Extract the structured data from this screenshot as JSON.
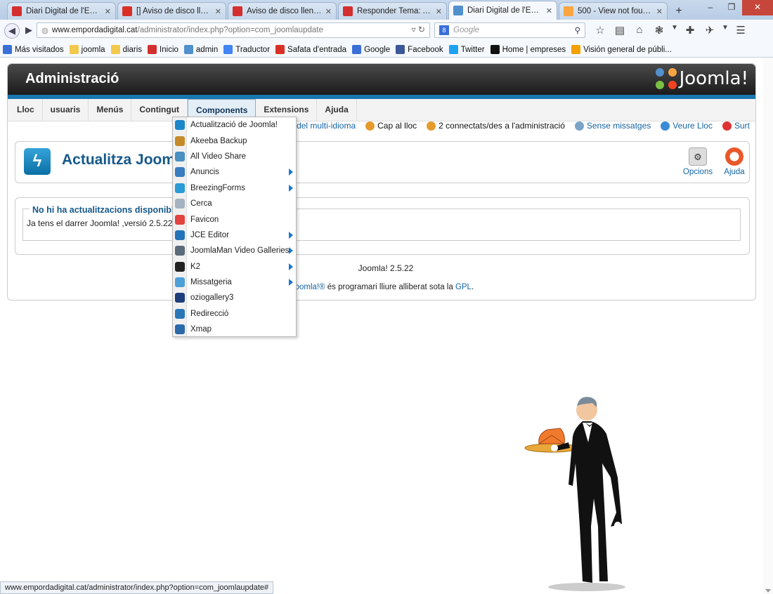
{
  "browser": {
    "tabs": [
      {
        "label": "Diari Digital de l'Emp...",
        "icon": "weebly-icon",
        "color": "#d32f2f",
        "active": false
      },
      {
        "label": "[] Aviso de disco llen...",
        "icon": "gmail-icon",
        "color": "#d93025",
        "active": false
      },
      {
        "label": "Aviso de disco lleno (...",
        "icon": "weebly-icon",
        "color": "#d32f2f",
        "active": false
      },
      {
        "label": "Responder Tema: Avi...",
        "icon": "weebly-icon",
        "color": "#d32f2f",
        "active": false
      },
      {
        "label": "Diari Digital de l'Emp...",
        "icon": "joomla-icon",
        "color": "#5091cd",
        "active": true
      },
      {
        "label": "500 - View not found ...",
        "icon": "joomla-icon",
        "color": "#f9a541",
        "active": false
      }
    ],
    "url_host": "www.empordadigital.cat",
    "url_path": "/administrator/index.php?option=com_joomlaupdate",
    "search_placeholder": "Google",
    "bookmarks": [
      {
        "label": "Más visitados",
        "icon": "bookmarks-icon",
        "color": "#3b6fd8"
      },
      {
        "label": "joomla",
        "icon": "folder-icon",
        "color": "#f2c94c"
      },
      {
        "label": "diaris",
        "icon": "folder-icon",
        "color": "#f2c94c"
      },
      {
        "label": "Inicio",
        "icon": "weebly-icon",
        "color": "#d32f2f"
      },
      {
        "label": "admin",
        "icon": "joomla-icon",
        "color": "#5091cd"
      },
      {
        "label": "Traductor",
        "icon": "translate-icon",
        "color": "#4285f4"
      },
      {
        "label": "Safata d'entrada",
        "icon": "gmail-icon",
        "color": "#d93025"
      },
      {
        "label": "Google",
        "icon": "google-icon",
        "color": "#3b6fd8"
      },
      {
        "label": "Facebook",
        "icon": "facebook-icon",
        "color": "#3b5998"
      },
      {
        "label": "Twitter",
        "icon": "twitter-icon",
        "color": "#1da1f2"
      },
      {
        "label": "Home | empreses",
        "icon": "site-icon",
        "color": "#111111"
      },
      {
        "label": "Visión general de públi...",
        "icon": "adsense-icon",
        "color": "#f4a100"
      }
    ],
    "status_url": "www.empordadigital.cat/administrator/index.php?option=com_joomlaupdate#"
  },
  "admin": {
    "title": "Administració",
    "logo_text": "Joomla!",
    "menu": [
      "Lloc",
      "usuaris",
      "Menús",
      "Contingut",
      "Components",
      "Extensions",
      "Ajuda"
    ],
    "status": [
      {
        "label": "Estat del multi-idioma",
        "color": "#2e7bb8",
        "dark": false
      },
      {
        "label": "Cap al lloc",
        "color": "#e59b2c",
        "dark": true
      },
      {
        "label": "2 connectats/des a l'administració",
        "color": "#e59b2c",
        "dark": true
      },
      {
        "label": "Sense missatges",
        "color": "#7aa3c8",
        "dark": false
      },
      {
        "label": "Veure Lloc",
        "color": "#3a8ad6",
        "dark": false
      },
      {
        "label": "Surt",
        "color": "#d33",
        "dark": false
      }
    ],
    "page_title": "Actualitza Joomla!",
    "toolbar": {
      "options_label": "Opcions",
      "help_label": "Ajuda"
    },
    "message": {
      "title": "No hi ha actualitzacions disponibles",
      "text": "Ja tens el darrer Joomla! ,versió 2.5.22."
    },
    "footer_version": "Joomla! 2.5.22",
    "footer_link": "Joomla!®",
    "footer_text": " és programari lliure alliberat sota la ",
    "footer_license": "GPL",
    "footer_end": "."
  },
  "components_menu": [
    {
      "label": "Actualització de Joomla!",
      "color": "#1b87c9",
      "submenu": false
    },
    {
      "label": "Akeeba Backup",
      "color": "#c58b2a",
      "submenu": false
    },
    {
      "label": "All Video Share",
      "color": "#4a90c2",
      "submenu": false
    },
    {
      "label": "Anuncis",
      "color": "#3a7cc0",
      "submenu": true
    },
    {
      "label": "BreezingForms",
      "color": "#2b9bd6",
      "submenu": true
    },
    {
      "label": "Cerca",
      "color": "#a5b3c0",
      "submenu": false
    },
    {
      "label": "Favicon",
      "color": "#e2433f",
      "submenu": false
    },
    {
      "label": "JCE Editor",
      "color": "#2573b8",
      "submenu": true
    },
    {
      "label": "JoomlaMan Video Galleries",
      "color": "#5a6b7a",
      "submenu": true
    },
    {
      "label": "K2",
      "color": "#222222",
      "submenu": true
    },
    {
      "label": "Missatgeria",
      "color": "#4ea0d8",
      "submenu": true
    },
    {
      "label": "oziogallery3",
      "color": "#1d3e7a",
      "submenu": false
    },
    {
      "label": "Redirecció",
      "color": "#2a77b8",
      "submenu": false
    },
    {
      "label": "Xmap",
      "color": "#2b6aa8",
      "submenu": false
    }
  ]
}
